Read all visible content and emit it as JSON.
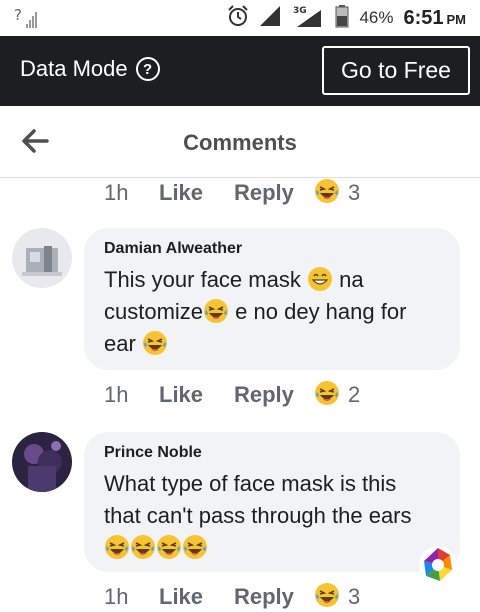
{
  "status_bar": {
    "unknown_signal": "?",
    "network_type": "3G",
    "battery": "46%",
    "time": "6:51",
    "ampm": "PM"
  },
  "data_bar": {
    "label": "Data Mode",
    "help": "?",
    "go_free": "Go to Free"
  },
  "header": {
    "title": "Comments"
  },
  "top_actions": {
    "time": "1h",
    "like": "Like",
    "reply": "Reply",
    "reaction_count": "3"
  },
  "comments": [
    {
      "author": "Damian Alweather",
      "line1": "This your face mask",
      "line1b": "na",
      "line2a": "customize",
      "line2b": "e no dey hang for",
      "line3": "ear",
      "time": "1h",
      "like": "Like",
      "reply": "Reply",
      "reaction_count": "2"
    },
    {
      "author": "Prince Noble",
      "line1": "What type of face mask is this",
      "line2": "that can't pass through the  ears",
      "time": "1h",
      "like": "Like",
      "reply": "Reply",
      "reaction_count": "3"
    }
  ],
  "colors": {
    "dark_bar": "#1c1e21",
    "bubble": "#f2f3f5",
    "meta_text": "#606770"
  }
}
